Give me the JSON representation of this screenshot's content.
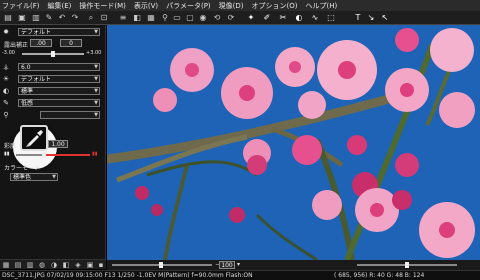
{
  "menu": [
    "ファイル(F)",
    "編集(E)",
    "操作モード(M)",
    "表示(V)",
    "パラメータ(P)",
    "現像(D)",
    "オプション(O)",
    "ヘルプ(H)"
  ],
  "panel": {
    "picture_mode": "デフォルト",
    "exposure_label": "露出補正",
    "exposure_value": ".00",
    "exposure_value2": "0",
    "range_min": "-3.00",
    "range_max": "+3.00",
    "wb_value": "6.0",
    "tone_value": "デフォルト",
    "contrast_value": "標準",
    "sharp_value": "低感",
    "saturation_label": "彩度",
    "saturation_value": "1.00",
    "color_mode_label": "カラーモード",
    "color_mode_value": "標準色"
  },
  "viewer": {
    "zoom_value": "100"
  },
  "status": {
    "left": "DSC_3711.JPG 07/02/19 09:15:00 F13 1/250 -1.0EV M(Pattern) f=90.0mm Flash:ON",
    "right": "( 685, 956) R: 40 G: 48 B: 124"
  },
  "colors": {
    "sky": "#1e63b5",
    "blossom": "#f07aa8",
    "panel_bg": "#141414"
  }
}
